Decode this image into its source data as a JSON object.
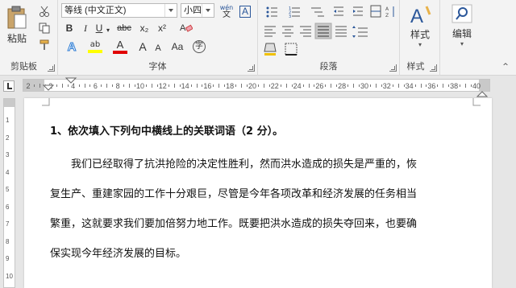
{
  "ribbon": {
    "clipboard": {
      "paste_label": "粘贴",
      "group_label": "剪贴板"
    },
    "font": {
      "font_name": "等线 (中文正文)",
      "font_size": "小四",
      "wen_glyph": "wén",
      "wen_char": "文",
      "group_label": "字体",
      "bold": "B",
      "italic": "I",
      "underline": "U",
      "strike": "abc",
      "subscript": "x₂",
      "superscript": "x²",
      "grow": "A",
      "shrink": "A",
      "aa": "Aa",
      "enclose": "字",
      "highlight": "ab",
      "font_color": "A"
    },
    "paragraph": {
      "group_label": "段落"
    },
    "styles": {
      "label": "样式",
      "group_label": "样式"
    },
    "editing": {
      "label": "编辑"
    }
  },
  "ruler": {
    "ticks": [
      "2",
      "2",
      "4",
      "6",
      "8",
      "10",
      "12",
      "14",
      "16",
      "18",
      "20",
      "22",
      "24",
      "26",
      "28",
      "30",
      "32",
      "34",
      "36",
      "38",
      "40"
    ],
    "vticks": [
      "1",
      "2",
      "3",
      "4",
      "5",
      "6",
      "7",
      "8",
      "9",
      "10"
    ]
  },
  "document": {
    "question": "1、依次填入下列句中横线上的关联词语（2 分）。",
    "lines": [
      "　　我们已经取得了抗洪抢险的决定性胜利，然而洪水造成的损失是严重的，恢",
      "复生产、重建家园的工作十分艰巨，尽管是今年各项改革和经济发展的任务相当",
      "繁重，这就要求我们要加倍努力地工作。既要把洪水造成的损失夺回来，也要确",
      "保实现今年经济发展的目标。"
    ]
  },
  "colors": {
    "highlight": "#ffff00",
    "font_color": "#e00000",
    "accent": "#2b579a"
  }
}
